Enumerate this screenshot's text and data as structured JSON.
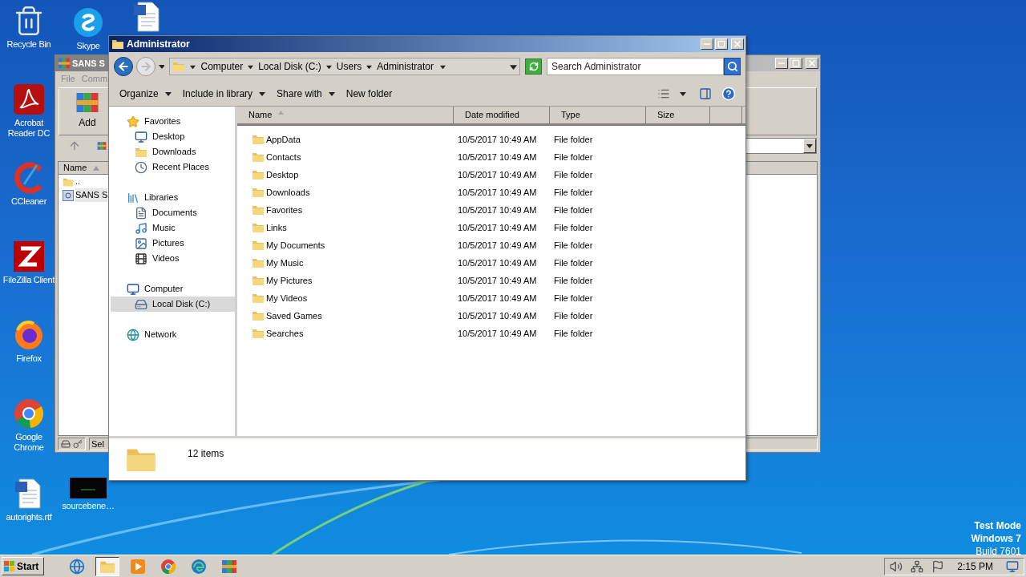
{
  "desktop_icons": [
    {
      "label": "Recycle Bin",
      "kind": "recycle"
    },
    {
      "label": "Acrobat Reader DC",
      "kind": "acrobat"
    },
    {
      "label": "CCleaner",
      "kind": "ccleaner"
    },
    {
      "label": "FileZilla Client",
      "kind": "filezilla"
    },
    {
      "label": "Firefox",
      "kind": "firefox"
    },
    {
      "label": "Google Chrome",
      "kind": "chrome"
    },
    {
      "label": "autorights.rtf",
      "kind": "word"
    },
    {
      "label": "Skype",
      "kind": "skype"
    },
    {
      "label": "sourcebene…",
      "kind": "dark"
    },
    {
      "kind": "word"
    }
  ],
  "background_window": {
    "title": "SANS S",
    "menu": [
      "File",
      "Comm"
    ],
    "toolbar_button": "Add",
    "column": "Name",
    "rows": [
      {
        "name": "..",
        "kind": "folder"
      },
      {
        "name": "SANS S",
        "kind": "file"
      }
    ],
    "status": "Sel"
  },
  "explorer": {
    "title": "Administrator",
    "breadcrumb": [
      "Computer",
      "Local Disk (C:)",
      "Users",
      "Administrator"
    ],
    "search": {
      "placeholder": "Search Administrator"
    },
    "toolbar": [
      {
        "label": "Organize",
        "dropdown": true
      },
      {
        "label": "Include in library",
        "dropdown": true
      },
      {
        "label": "Share with",
        "dropdown": true
      },
      {
        "label": "New folder",
        "dropdown": false
      }
    ],
    "nav": [
      {
        "label": "Favorites",
        "kind": "star",
        "selected": false,
        "children": [
          {
            "label": "Desktop",
            "kind": "desktop",
            "selected": false
          },
          {
            "label": "Downloads",
            "kind": "downloads",
            "selected": false
          },
          {
            "label": "Recent Places",
            "kind": "recent",
            "selected": false
          }
        ]
      },
      {
        "label": "Libraries",
        "kind": "libraries",
        "selected": false,
        "children": [
          {
            "label": "Documents",
            "kind": "documents",
            "selected": false
          },
          {
            "label": "Music",
            "kind": "music",
            "selected": false
          },
          {
            "label": "Pictures",
            "kind": "pictures",
            "selected": false
          },
          {
            "label": "Videos",
            "kind": "videos",
            "selected": false
          }
        ]
      },
      {
        "label": "Computer",
        "kind": "computer",
        "selected": false,
        "children": [
          {
            "label": "Local Disk (C:)",
            "kind": "disk",
            "selected": true
          }
        ]
      },
      {
        "label": "Network",
        "kind": "network",
        "selected": false
      }
    ],
    "columns": [
      {
        "label": "Name",
        "sorted": true
      },
      {
        "label": "Date modified",
        "sorted": false
      },
      {
        "label": "Type",
        "sorted": false
      },
      {
        "label": "Size",
        "sorted": false
      }
    ],
    "files": [
      {
        "name": "AppData",
        "date": "10/5/2017 10:49 AM",
        "type": "File folder"
      },
      {
        "name": "Contacts",
        "date": "10/5/2017 10:49 AM",
        "type": "File folder"
      },
      {
        "name": "Desktop",
        "date": "10/5/2017 10:49 AM",
        "type": "File folder"
      },
      {
        "name": "Downloads",
        "date": "10/5/2017 10:49 AM",
        "type": "File folder"
      },
      {
        "name": "Favorites",
        "date": "10/5/2017 10:49 AM",
        "type": "File folder"
      },
      {
        "name": "Links",
        "date": "10/5/2017 10:49 AM",
        "type": "File folder"
      },
      {
        "name": "My Documents",
        "date": "10/5/2017 10:49 AM",
        "type": "File folder"
      },
      {
        "name": "My Music",
        "date": "10/5/2017 10:49 AM",
        "type": "File folder"
      },
      {
        "name": "My Pictures",
        "date": "10/5/2017 10:49 AM",
        "type": "File folder"
      },
      {
        "name": "My Videos",
        "date": "10/5/2017 10:49 AM",
        "type": "File folder"
      },
      {
        "name": "Saved Games",
        "date": "10/5/2017 10:49 AM",
        "type": "File folder"
      },
      {
        "name": "Searches",
        "date": "10/5/2017 10:49 AM",
        "type": "File folder"
      }
    ],
    "status": "12 items"
  },
  "desktop_text": [
    "Test Mode",
    "Windows 7",
    "Build 7601"
  ],
  "taskbar": {
    "start": "Start",
    "apps": [
      {
        "kind": "ie",
        "selected": false
      },
      {
        "kind": "explorer",
        "selected": true
      },
      {
        "kind": "media",
        "selected": false
      },
      {
        "kind": "chrome",
        "selected": false
      },
      {
        "kind": "edge",
        "selected": false
      },
      {
        "kind": "winrar",
        "selected": false
      }
    ],
    "clock": "2:15 PM"
  }
}
